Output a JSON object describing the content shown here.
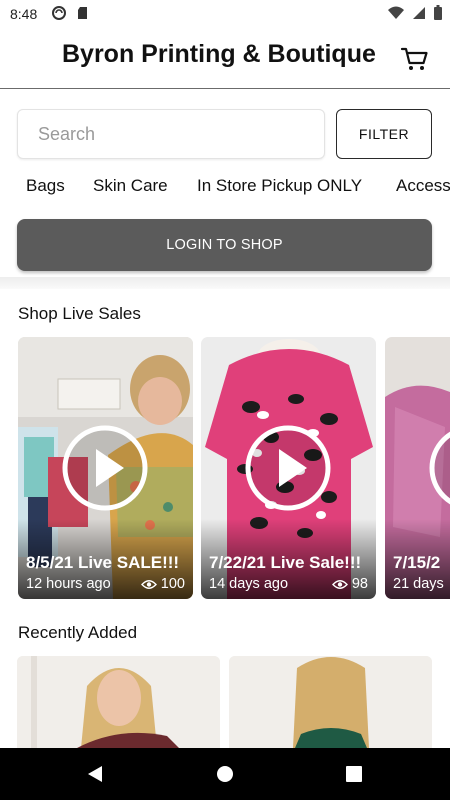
{
  "status_bar": {
    "time": "8:48",
    "icons": [
      "sync-icon",
      "sd-card-icon",
      "wifi-icon",
      "signal-icon",
      "battery-icon"
    ]
  },
  "header": {
    "title": "Byron Printing & Boutique",
    "cart_icon": "cart-icon"
  },
  "search": {
    "placeholder": "Search",
    "filter_label": "FILTER"
  },
  "categories": [
    "Bags",
    "Skin Care",
    "In Store Pickup ONLY",
    "Access"
  ],
  "login_label": "LOGIN TO SHOP",
  "live_sales": {
    "title": "Shop Live Sales",
    "cards": [
      {
        "title": "8/5/21 Live SALE!!!",
        "time": "12 hours ago",
        "views": "100"
      },
      {
        "title": "7/22/21 Live Sale!!!",
        "time": "14 days ago",
        "views": "98"
      },
      {
        "title": "7/15/2",
        "time": "21 days",
        "views": ""
      }
    ]
  },
  "recently_added": {
    "title": "Recently Added"
  },
  "colors": {
    "login_bg": "#5b5b5b",
    "nav_bg": "#000000",
    "pink": "#e0407a"
  }
}
